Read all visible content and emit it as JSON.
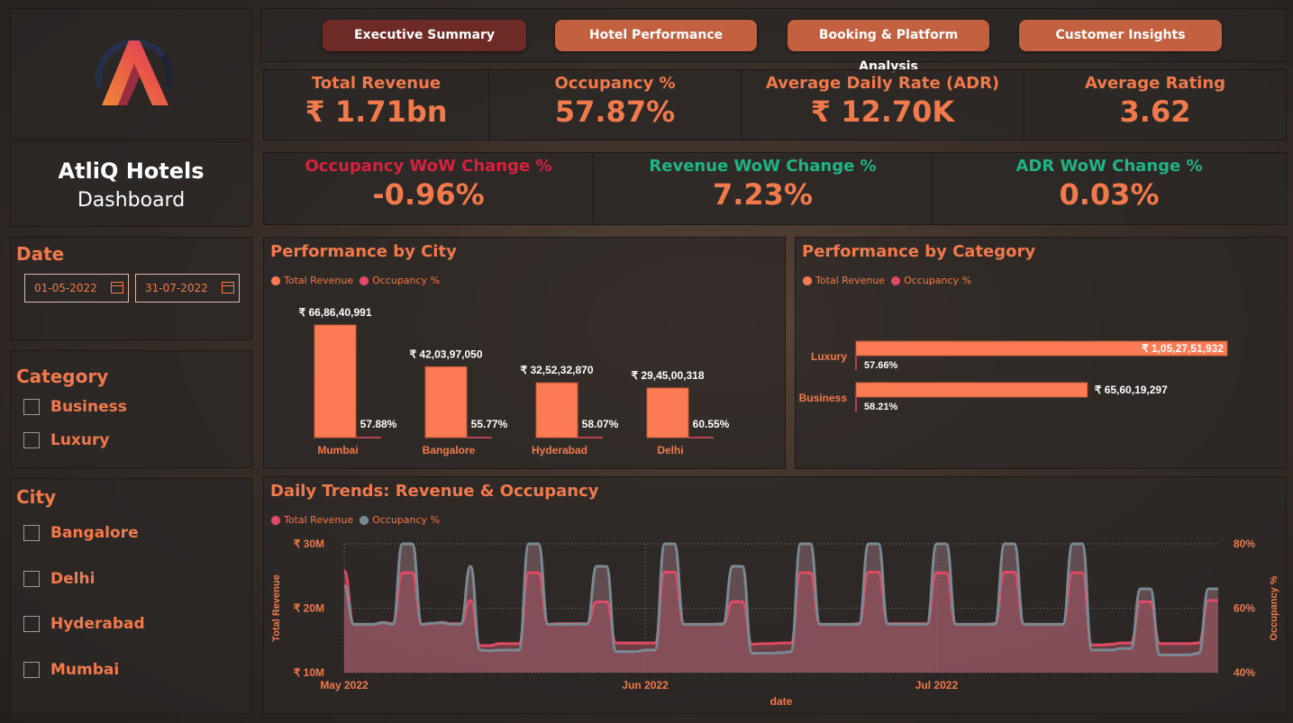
{
  "app": {
    "name": "AtliQ Hotels",
    "subtitle": "Dashboard"
  },
  "nav": {
    "tabs": [
      {
        "label": "Executive Summary",
        "active": true
      },
      {
        "label": "Hotel Performance",
        "active": false
      },
      {
        "label": "Booking & Platform Analysis",
        "active": false
      },
      {
        "label": "Customer Insights",
        "active": false
      }
    ]
  },
  "kpis_row1": [
    {
      "label": "Total Revenue",
      "value": "₹ 1.71bn"
    },
    {
      "label": "Occupancy %",
      "value": "57.87%"
    },
    {
      "label": "Average Daily Rate (ADR)",
      "value": "₹ 12.70K"
    },
    {
      "label": "Average Rating",
      "value": "3.62"
    }
  ],
  "kpis_row2": [
    {
      "label": "Occupancy WoW Change %",
      "value": "-0.96%",
      "label_color": "#d8203f"
    },
    {
      "label": "Revenue WoW Change %",
      "value": "7.23%",
      "label_color": "#1fb385"
    },
    {
      "label": "ADR WoW Change %",
      "value": "0.03%",
      "label_color": "#1fb385"
    }
  ],
  "filters": {
    "date": {
      "title": "Date",
      "start": "01-05-2022",
      "end": "31-07-2022"
    },
    "category": {
      "title": "Category",
      "options": [
        "Business",
        "Luxury"
      ]
    },
    "city": {
      "title": "City",
      "options": [
        "Bangalore",
        "Delhi",
        "Hyderabad",
        "Mumbai"
      ]
    }
  },
  "colors": {
    "accent": "#f07a4c",
    "bar": "#fb7b54",
    "line_revenue": "#e04a64",
    "line_occupancy": "#7a8a93",
    "active_tab": "#6e2a25",
    "tab": "#c2603f"
  },
  "chart_data": [
    {
      "id": "city",
      "type": "bar",
      "title": "Performance by City",
      "legend": [
        "Total Revenue",
        "Occupancy %"
      ],
      "categories": [
        "Mumbai",
        "Bangalore",
        "Hyderabad",
        "Delhi"
      ],
      "series": [
        {
          "name": "Total Revenue",
          "values": [
            668640991,
            420397050,
            325232870,
            294500318
          ],
          "labels": [
            "₹ 66,86,40,991",
            "₹ 42,03,97,050",
            "₹ 32,52,32,870",
            "₹ 29,45,00,318"
          ]
        },
        {
          "name": "Occupancy %",
          "values": [
            57.88,
            55.77,
            58.07,
            60.55
          ],
          "labels": [
            "57.88%",
            "55.77%",
            "58.07%",
            "60.55%"
          ]
        }
      ]
    },
    {
      "id": "category",
      "type": "bar",
      "orientation": "horizontal",
      "title": "Performance by Category",
      "legend": [
        "Total Revenue",
        "Occupancy %"
      ],
      "categories": [
        "Luxury",
        "Business"
      ],
      "series": [
        {
          "name": "Total Revenue",
          "values": [
            1052751932,
            656019297
          ],
          "labels": [
            "₹ 1,05,27,51,932",
            "₹ 65,60,19,297"
          ]
        },
        {
          "name": "Occupancy %",
          "values": [
            57.66,
            58.21
          ],
          "labels": [
            "57.66%",
            "58.21%"
          ]
        }
      ]
    },
    {
      "id": "trend",
      "type": "area",
      "title": "Daily Trends: Revenue & Occupancy",
      "legend": [
        "Total Revenue",
        "Occupancy %"
      ],
      "xlabel": "date",
      "ylabel": "Total Revenue",
      "y2label": "Occupancy %",
      "ylim": [
        10,
        30
      ],
      "y2lim": [
        40,
        80
      ],
      "yticks": [
        "₹ 10M",
        "₹ 20M",
        "₹ 30M"
      ],
      "y2ticks": [
        "40%",
        "60%",
        "80%"
      ],
      "xticks": [
        "May 2022",
        "Jun 2022",
        "Jul 2022"
      ],
      "x_start": "2022-05-01",
      "x_end": "2022-07-31",
      "series": [
        {
          "name": "Total Revenue",
          "unit": "M",
          "values": [
            25.8,
            17.5,
            17.5,
            17.5,
            17.8,
            17.6,
            25.5,
            25.5,
            17.5,
            17.6,
            17.8,
            17.6,
            17.6,
            21.2,
            14.2,
            14.2,
            14.5,
            14.5,
            14.5,
            25.5,
            25.5,
            17.5,
            17.6,
            17.6,
            17.6,
            17.6,
            21.0,
            21.0,
            14.6,
            14.6,
            14.6,
            14.6,
            14.6,
            25.6,
            25.6,
            17.5,
            17.5,
            17.5,
            17.5,
            17.6,
            21.0,
            21.0,
            14.4,
            14.5,
            14.5,
            14.6,
            14.6,
            25.5,
            25.5,
            17.5,
            17.5,
            17.5,
            17.5,
            17.6,
            25.6,
            25.6,
            17.6,
            17.6,
            17.6,
            17.6,
            17.6,
            25.5,
            25.5,
            17.5,
            17.5,
            17.5,
            17.5,
            17.6,
            25.6,
            25.6,
            17.5,
            17.5,
            17.5,
            17.5,
            17.5,
            25.5,
            25.5,
            14.3,
            14.3,
            14.4,
            14.6,
            14.6,
            21.0,
            21.0,
            14.5,
            14.5,
            14.5,
            14.5,
            14.6,
            21.2,
            21.2
          ]
        },
        {
          "name": "Occupancy %",
          "unit": "%",
          "values": [
            67.0,
            55.0,
            55.0,
            55.0,
            55.5,
            55.0,
            80.0,
            80.0,
            55.0,
            55.3,
            55.5,
            55.0,
            55.0,
            73.0,
            47.0,
            46.8,
            47.0,
            47.0,
            47.0,
            80.0,
            80.0,
            55.0,
            55.0,
            55.0,
            55.0,
            55.0,
            73.0,
            73.0,
            46.5,
            46.5,
            46.5,
            47.0,
            47.0,
            80.0,
            80.0,
            55.0,
            55.0,
            55.0,
            55.0,
            55.0,
            73.0,
            73.0,
            46.0,
            46.0,
            46.0,
            46.2,
            46.5,
            80.0,
            80.0,
            55.0,
            55.0,
            55.0,
            55.0,
            55.0,
            80.0,
            80.0,
            55.0,
            55.0,
            55.0,
            55.0,
            55.0,
            80.0,
            80.0,
            55.0,
            55.0,
            55.0,
            55.0,
            55.0,
            80.0,
            80.0,
            55.0,
            55.0,
            55.0,
            55.0,
            55.0,
            80.0,
            80.0,
            47.0,
            47.0,
            47.0,
            47.5,
            47.5,
            66.0,
            66.0,
            45.5,
            45.5,
            45.5,
            45.5,
            46.0,
            66.0,
            66.0
          ]
        }
      ]
    }
  ]
}
